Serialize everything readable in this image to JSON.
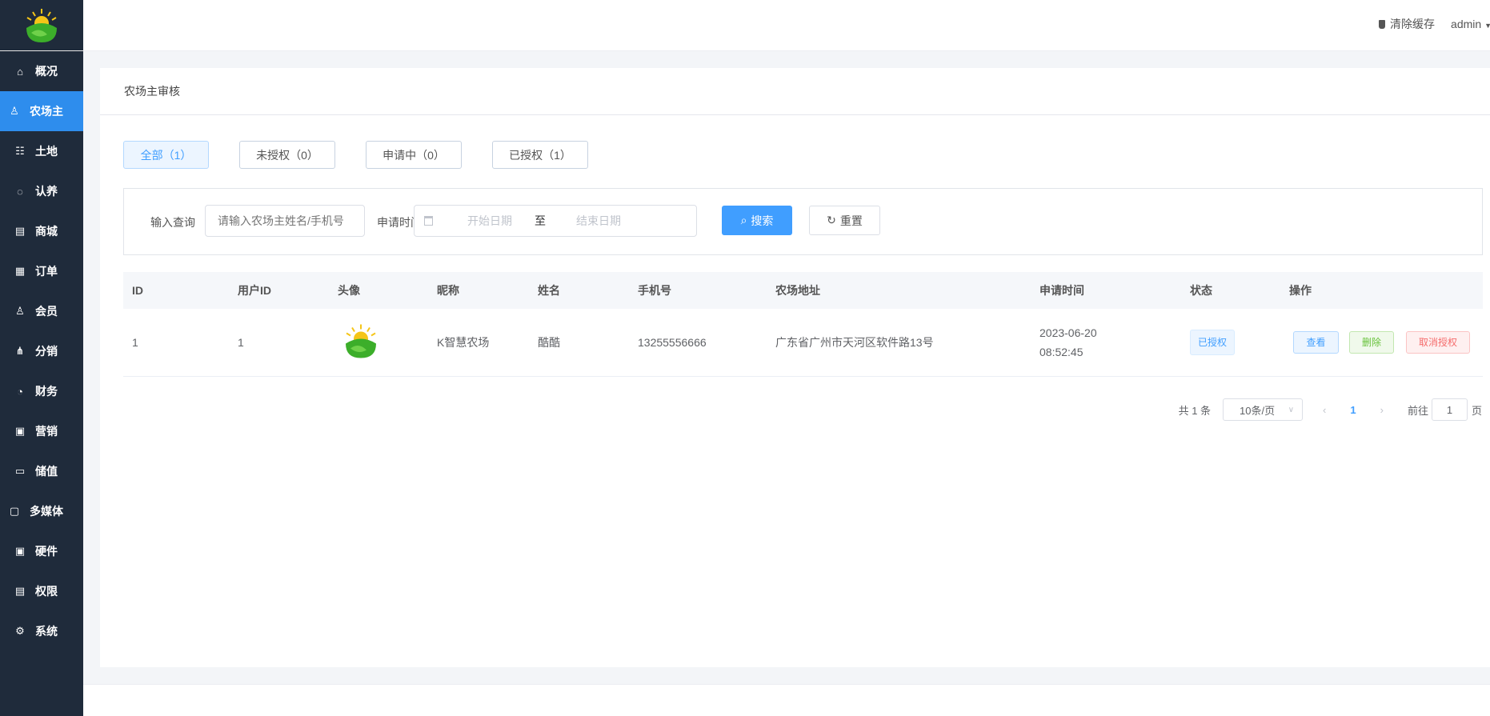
{
  "sidebar": {
    "items": [
      {
        "label": "概况",
        "icon": "home-icon"
      },
      {
        "label": "农场主",
        "icon": "user-stamp-icon"
      },
      {
        "label": "土地",
        "icon": "land-icon"
      },
      {
        "label": "认养",
        "icon": "adopt-icon"
      },
      {
        "label": "商城",
        "icon": "store-icon"
      },
      {
        "label": "订单",
        "icon": "clipboard-icon"
      },
      {
        "label": "会员",
        "icon": "user-icon"
      },
      {
        "label": "分销",
        "icon": "share-icon"
      },
      {
        "label": "财务",
        "icon": "pie-chart-icon"
      },
      {
        "label": "营销",
        "icon": "marketing-icon"
      },
      {
        "label": "储值",
        "icon": "wallet-icon"
      },
      {
        "label": "多媒体",
        "icon": "monitor-icon"
      },
      {
        "label": "硬件",
        "icon": "hardware-icon"
      },
      {
        "label": "权限",
        "icon": "permission-icon"
      },
      {
        "label": "系统",
        "icon": "gear-icon"
      }
    ],
    "active": "农场主"
  },
  "header": {
    "clear_cache": "清除缓存",
    "user": "admin"
  },
  "page": {
    "title": "农场主审核"
  },
  "tabs": [
    {
      "label": "全部（1）"
    },
    {
      "label": "未授权（0）"
    },
    {
      "label": "申请中（0）"
    },
    {
      "label": "已授权（1）"
    }
  ],
  "filter": {
    "query_label": "输入查询",
    "query_placeholder": "请输入农场主姓名/手机号",
    "time_label": "申请时间",
    "start_placeholder": "开始日期",
    "range_sep": "至",
    "end_placeholder": "结束日期",
    "search": "搜索",
    "reset": "重置"
  },
  "table": {
    "columns": [
      "ID",
      "用户ID",
      "头像",
      "昵称",
      "姓名",
      "手机号",
      "农场地址",
      "申请时间",
      "状态",
      "操作"
    ],
    "rows": [
      {
        "id": "1",
        "user_id": "1",
        "nickname": "K智慧农场",
        "name": "酷酷",
        "phone": "13255556666",
        "address": "广东省广州市天河区软件路13号",
        "date": "2023-06-20",
        "time": "08:52:45",
        "status": "已授权",
        "actions": {
          "view": "查看",
          "delete": "删除",
          "revoke": "取消授权"
        }
      }
    ]
  },
  "pagination": {
    "total": "共 1 条",
    "page_size": "10条/页",
    "current": "1",
    "goto_label": "前往",
    "goto_value": "1",
    "page_suffix": "页"
  },
  "colors": {
    "sidebar": "#1f2b3b",
    "active": "#2e8ded",
    "primary": "#409eff"
  }
}
